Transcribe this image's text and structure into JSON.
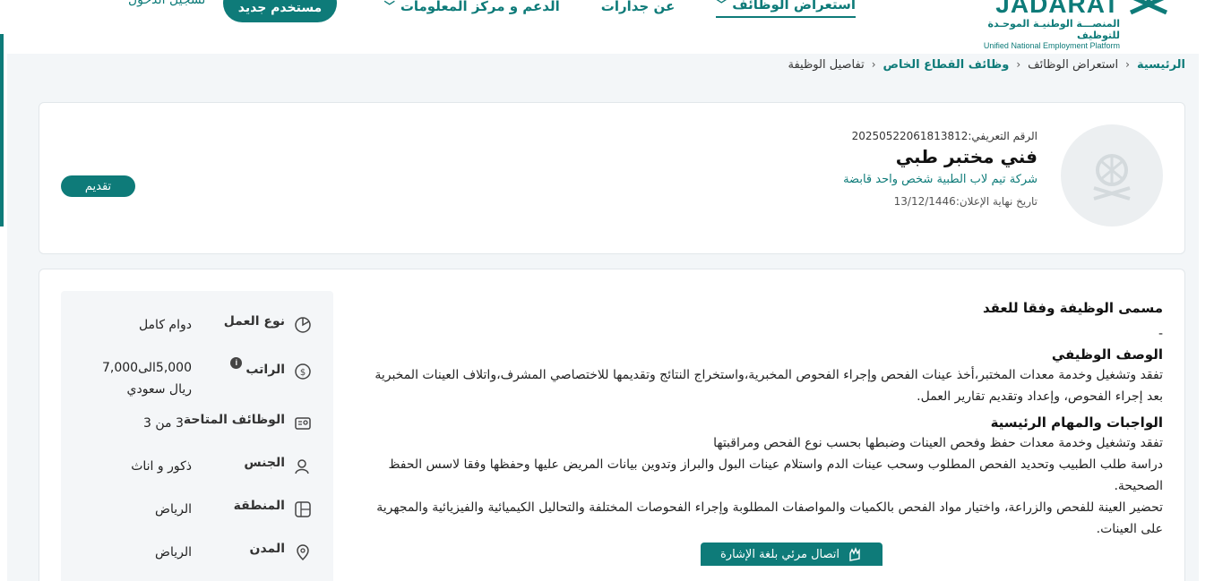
{
  "header": {
    "logo_text": "JADARAT",
    "logo_ar": "المنصـــة الوطنيـة الموحـدة للتوظيف",
    "logo_en": "Unified National Employment Platform",
    "nav": [
      {
        "label": "استعراض الوظائف",
        "has_dropdown": true,
        "active": true
      },
      {
        "label": "عن جدارات",
        "has_dropdown": false,
        "active": false
      },
      {
        "label": "الدعم و مركز المعلومات",
        "has_dropdown": true,
        "active": false
      }
    ],
    "register_label": "مستخدم جديد",
    "login_label": "تسجيل الدخول"
  },
  "breadcrumb": [
    {
      "label": "الرئيسية",
      "link": true
    },
    {
      "label": "استعراض الوظائف",
      "link": false
    },
    {
      "label": "وظائف القطاع الخاص",
      "link": true
    },
    {
      "label": "تفاصيل الوظيفة",
      "link": false
    }
  ],
  "job": {
    "id_line": "الرقم التعريفي:20250522061813812",
    "title": "فني مختبر طبي",
    "company": "شركة تيم لاب الطبية شخص واحد قابضة",
    "deadline_line": "تاريخ نهاية الإعلان:13/12/1446",
    "apply_label": "تقديم"
  },
  "description": {
    "contract_title_heading": "مسمى الوظيفة وفقا للعقد",
    "contract_title_value": "-",
    "job_desc_heading": "الوصف الوظيفي",
    "job_desc_text": "تفقد وتشغيل وخدمة معدات المختبر،أخذ عينات الفحص وإجراء الفحوص المخبرية،واستخراج النتائج وتقديمها للاختصاصي المشرف،واتلاف العينات المخبرية بعد إجراء الفحوص، وإعداد وتقديم تقارير العمل.",
    "duties_heading": "الواجبات والمهام الرئيسية",
    "duties": [
      "تفقد وتشغيل وخدمة معدات حفظ وفحص العينات وضبطها بحسب نوع الفحص ومراقبتها",
      "دراسة طلب الطبيب وتحديد الفحص المطلوب وسحب عينات الدم واستلام عينات البول والبراز وتدوين بيانات المريض عليها وحفظها وفقا لاسس الحفظ الصحيحة.",
      "تحضير العينة للفحص والزراعة، واختيار مواد الفحص بالكميات والمواصفات المطلوبة وإجراء الفحوصات المختلفة والتحاليل الكيميائية والفيزيائية والمجهرية على العينات."
    ]
  },
  "details": [
    {
      "icon": "pie-chart-icon",
      "label": "نوع العمل",
      "value": "دوام كامل"
    },
    {
      "icon": "money-icon",
      "label": "الراتب",
      "value": "5,000الى7,000 ريال سعودي"
    },
    {
      "icon": "id-card-icon",
      "label": "الوظائف المتاحة",
      "value": "3 من 3"
    },
    {
      "icon": "user-icon",
      "label": "الجنس",
      "value": "ذكور و اناث"
    },
    {
      "icon": "map-icon",
      "label": "المنطقة",
      "value": "الرياض"
    },
    {
      "icon": "location-pin-icon",
      "label": "المدن",
      "value": "الرياض"
    }
  ],
  "sign_language_label": "اتصال مرئي بلغة الإشارة",
  "colors": {
    "brand": "#0e7b79",
    "background": "#f3f6f8"
  }
}
